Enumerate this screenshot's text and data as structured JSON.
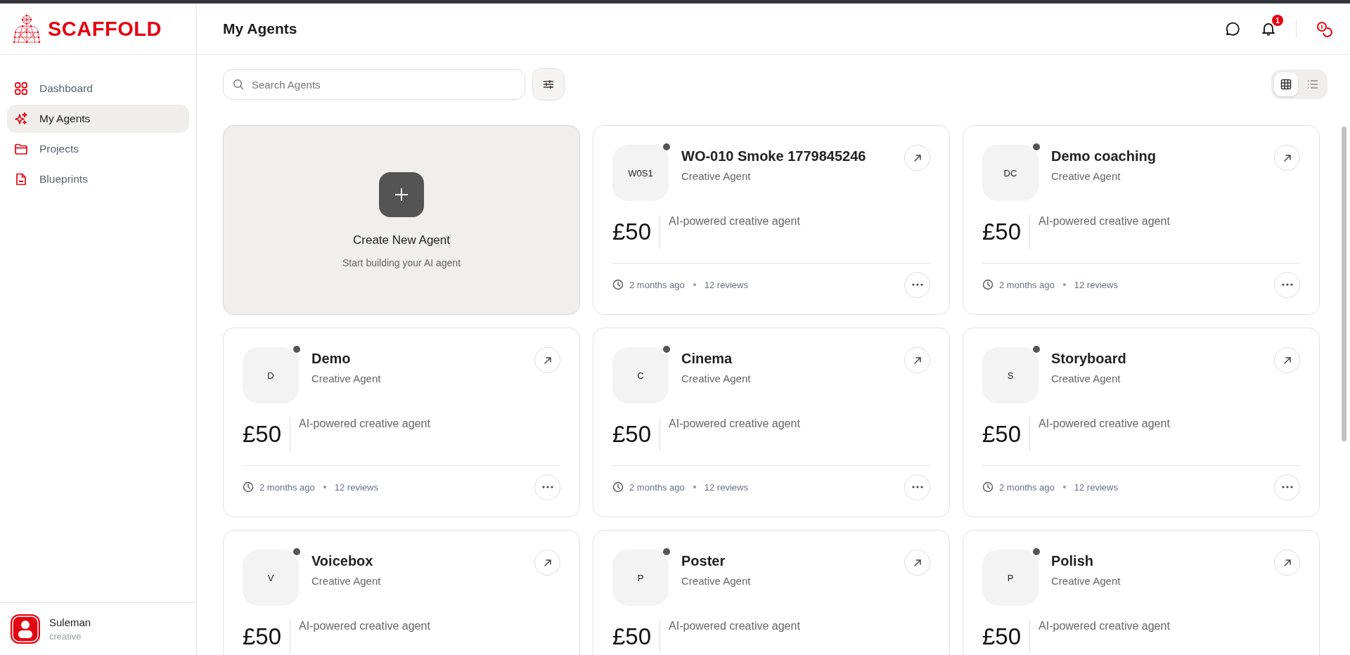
{
  "brand": {
    "name": "SCAFFOLD"
  },
  "sidebar": {
    "items": [
      {
        "label": "Dashboard",
        "selected": false
      },
      {
        "label": "My Agents",
        "selected": true
      },
      {
        "label": "Projects",
        "selected": false
      },
      {
        "label": "Blueprints",
        "selected": false
      }
    ],
    "user": {
      "name": "Suleman",
      "role": "creative"
    }
  },
  "header": {
    "title": "My Agents",
    "notification_count": "1"
  },
  "search": {
    "placeholder": "Search Agents"
  },
  "view_toggle": [
    {
      "selected": true
    },
    {
      "selected": false
    }
  ],
  "create_card": {
    "title": "Create New Agent",
    "subtitle": "Start building your AI agent"
  },
  "agents": [
    {
      "initials": "W0S1",
      "name": "WO-010 Smoke 1779845246",
      "type": "Creative Agent",
      "price": "£50",
      "description": "AI-powered creative agent",
      "updated": "2 months ago",
      "reviews": "12 reviews"
    },
    {
      "initials": "DC",
      "name": "Demo coaching",
      "type": "Creative Agent",
      "price": "£50",
      "description": "AI-powered creative agent",
      "updated": "2 months ago",
      "reviews": "12 reviews"
    },
    {
      "initials": "D",
      "name": "Demo",
      "type": "Creative Agent",
      "price": "£50",
      "description": "AI-powered creative agent",
      "updated": "2 months ago",
      "reviews": "12 reviews"
    },
    {
      "initials": "C",
      "name": "Cinema",
      "type": "Creative Agent",
      "price": "£50",
      "description": "AI-powered creative agent",
      "updated": "2 months ago",
      "reviews": "12 reviews"
    },
    {
      "initials": "S",
      "name": "Storyboard",
      "type": "Creative Agent",
      "price": "£50",
      "description": "AI-powered creative agent",
      "updated": "2 months ago",
      "reviews": "12 reviews"
    },
    {
      "initials": "V",
      "name": "Voicebox",
      "type": "Creative Agent",
      "price": "£50",
      "description": "AI-powered creative agent"
    },
    {
      "initials": "P",
      "name": "Poster",
      "type": "Creative Agent",
      "price": "£50",
      "description": "AI-powered creative agent"
    },
    {
      "initials": "P",
      "name": "Polish",
      "type": "Creative Agent",
      "price": "£50",
      "description": "AI-powered creative agent"
    }
  ]
}
